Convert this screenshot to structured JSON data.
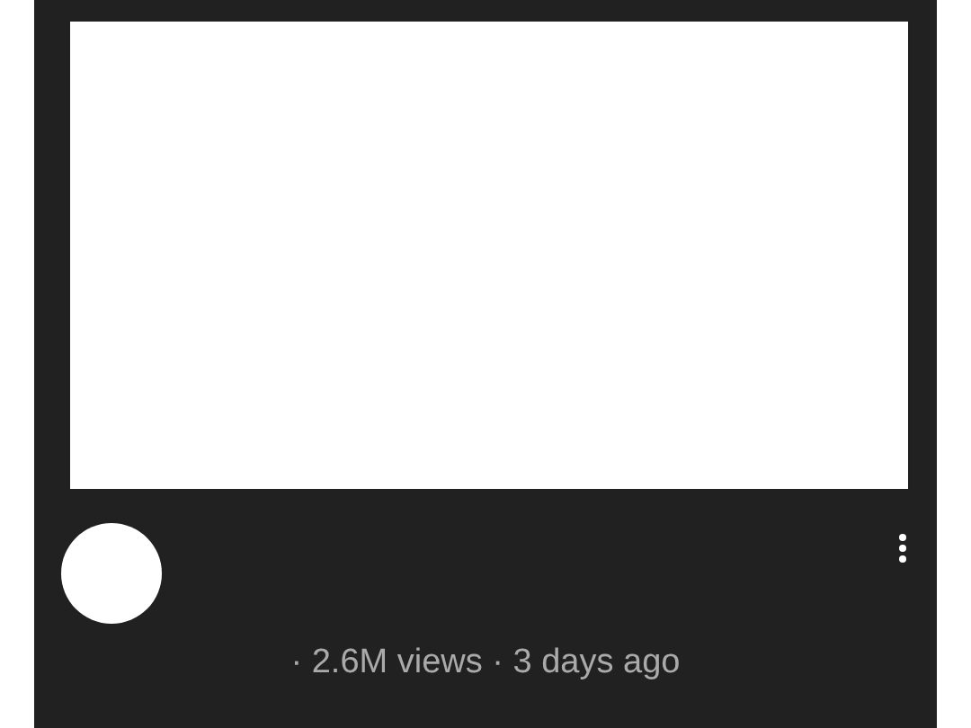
{
  "video": {
    "meta": "· 2.6M views · 3 days ago"
  }
}
